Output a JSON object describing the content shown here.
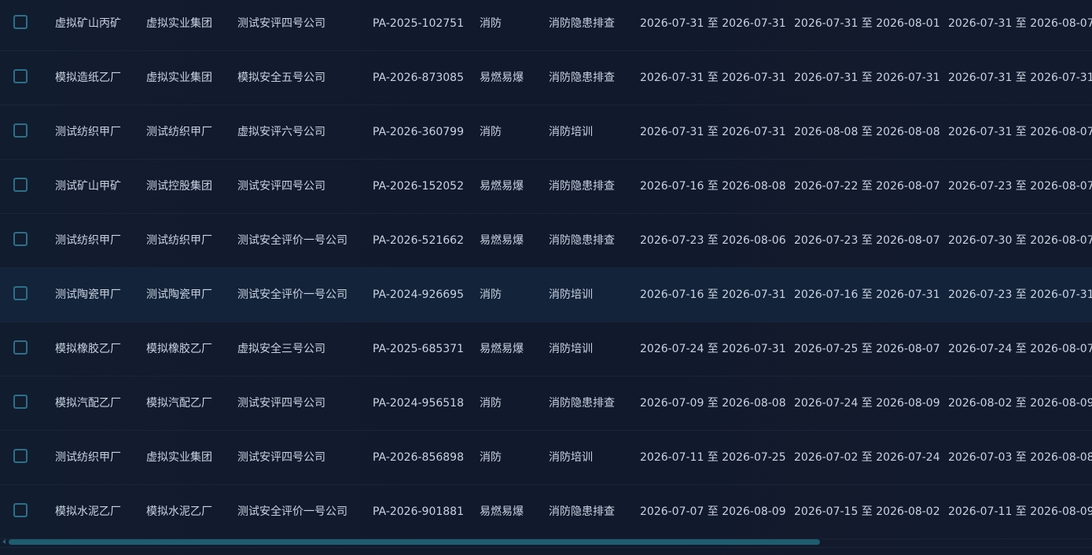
{
  "table": {
    "rows": [
      [
        "虚拟矿山丙矿",
        "虚拟实业集团",
        "测试安评四号公司",
        "PA-2025-102751",
        "消防",
        "消防隐患排查",
        "2026-07-31 至 2026-07-31",
        "2026-07-31 至 2026-08-01",
        "2026-07-31 至 2026-08-07"
      ],
      [
        "模拟造纸乙厂",
        "虚拟实业集团",
        "模拟安全五号公司",
        "PA-2026-873085",
        "易燃易爆",
        "消防隐患排查",
        "2026-07-31 至 2026-07-31",
        "2026-07-31 至 2026-07-31",
        "2026-07-31 至 2026-07-31"
      ],
      [
        "测试纺织甲厂",
        "测试纺织甲厂",
        "虚拟安评六号公司",
        "PA-2026-360799",
        "消防",
        "消防培训",
        "2026-07-31 至 2026-07-31",
        "2026-08-08 至 2026-08-08",
        "2026-07-31 至 2026-08-07"
      ],
      [
        "测试矿山甲矿",
        "测试控股集团",
        "测试安评四号公司",
        "PA-2026-152052",
        "易燃易爆",
        "消防隐患排查",
        "2026-07-16 至 2026-08-08",
        "2026-07-22 至 2026-08-07",
        "2026-07-23 至 2026-08-07"
      ],
      [
        "测试纺织甲厂",
        "测试纺织甲厂",
        "测试安全评价一号公司",
        "PA-2026-521662",
        "易燃易爆",
        "消防隐患排查",
        "2026-07-23 至 2026-08-06",
        "2026-07-23 至 2026-08-07",
        "2026-07-30 至 2026-08-07"
      ],
      [
        "测试陶瓷甲厂",
        "测试陶瓷甲厂",
        "测试安全评价一号公司",
        "PA-2024-926695",
        "消防",
        "消防培训",
        "2026-07-16 至 2026-07-31",
        "2026-07-16 至 2026-07-31",
        "2026-07-23 至 2026-07-31"
      ],
      [
        "模拟橡胶乙厂",
        "模拟橡胶乙厂",
        "虚拟安全三号公司",
        "PA-2025-685371",
        "易燃易爆",
        "消防培训",
        "2026-07-24 至 2026-07-31",
        "2026-07-25 至 2026-08-07",
        "2026-07-24 至 2026-08-07"
      ],
      [
        "模拟汽配乙厂",
        "模拟汽配乙厂",
        "测试安评四号公司",
        "PA-2024-956518",
        "消防",
        "消防隐患排查",
        "2026-07-09 至 2026-08-08",
        "2026-07-24 至 2026-08-09",
        "2026-08-02 至 2026-08-09"
      ],
      [
        "测试纺织甲厂",
        "虚拟实业集团",
        "测试安评四号公司",
        "PA-2026-856898",
        "消防",
        "消防培训",
        "2026-07-11 至 2026-07-25",
        "2026-07-02 至 2026-07-24",
        "2026-07-03 至 2026-08-08"
      ],
      [
        "模拟水泥乙厂",
        "模拟水泥乙厂",
        "测试安全评价一号公司",
        "PA-2026-901881",
        "易燃易爆",
        "消防隐患排查",
        "2026-07-07 至 2026-08-09",
        "2026-07-15 至 2026-08-02",
        "2026-07-11 至 2026-08-09"
      ]
    ],
    "highlighted_row": 5
  },
  "colors": {
    "background": "#111a2c",
    "row_divider": "#1a2538",
    "highlight_row": "#13233a",
    "text": "#c9d3e0",
    "checkbox_border": "#2c6f86",
    "scrollbar_thumb": "#1f5c70"
  },
  "scrollbar": {
    "visible_fraction": 0.74
  }
}
